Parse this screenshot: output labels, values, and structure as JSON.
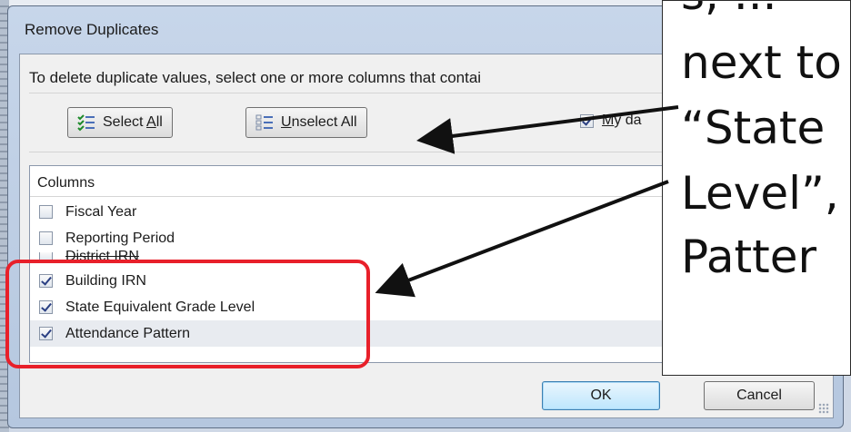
{
  "dialog": {
    "title": "Remove Duplicates",
    "instruction": "To delete duplicate values, select one or more columns that contai",
    "select_all_pre": "Select ",
    "select_all_key": "A",
    "select_all_post": "ll",
    "unselect_all_key": "U",
    "unselect_all_post": "nselect All",
    "has_headers_key": "M",
    "has_headers_post": "y da",
    "has_headers_checked": true,
    "columns_header": "Columns",
    "columns": [
      {
        "label": "Fiscal Year",
        "checked": false
      },
      {
        "label": "Reporting Period",
        "checked": false
      },
      {
        "label": "District IRN",
        "checked": false
      },
      {
        "label": "Building IRN",
        "checked": true
      },
      {
        "label": "State Equivalent Grade Level",
        "checked": true
      },
      {
        "label": "Attendance Pattern",
        "checked": true
      }
    ],
    "ok_label": "OK",
    "cancel_label": "Cancel"
  },
  "callout": {
    "lines": [
      "s, ...",
      "next to",
      "“State",
      "Level”,",
      "Patter"
    ]
  },
  "colors": {
    "highlight_box": "#e8202a",
    "ok_button_border": "#3c7fb1",
    "dialog_frame": "#b5c7df"
  }
}
